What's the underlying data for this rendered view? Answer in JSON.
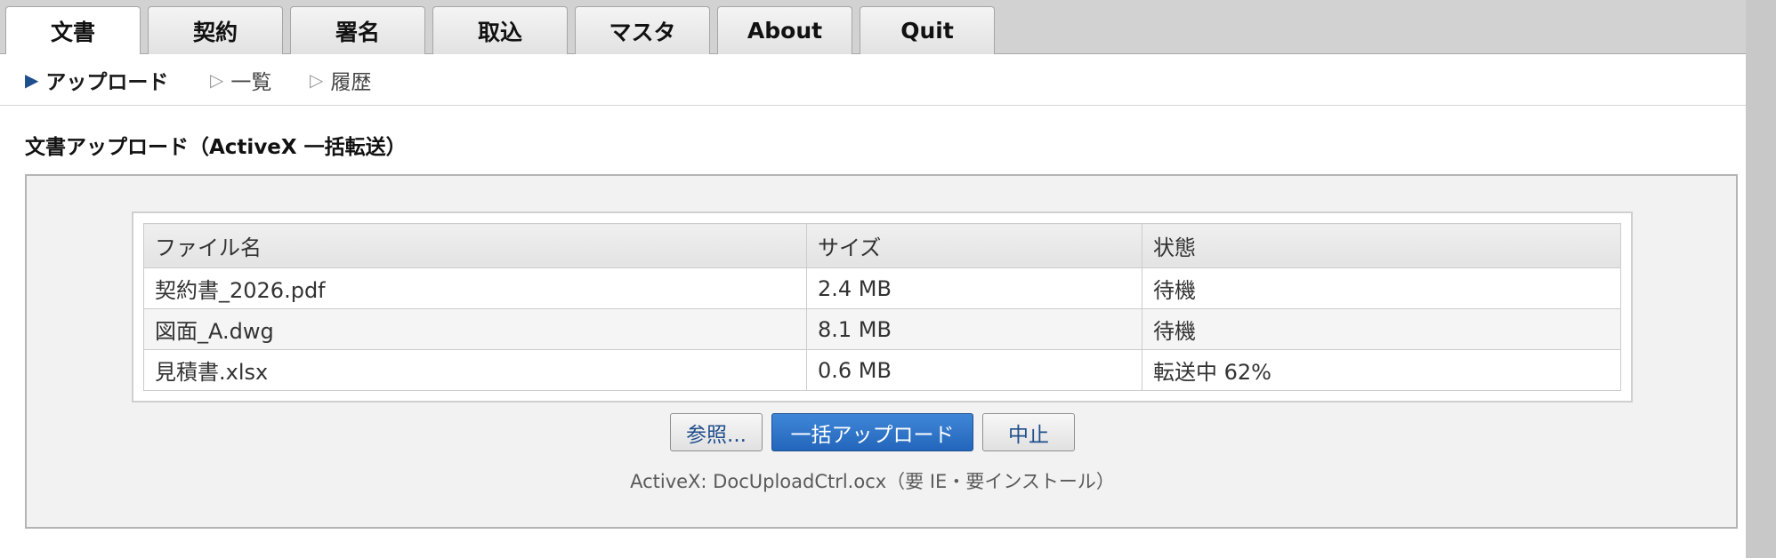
{
  "tabs": [
    "文書",
    "契約",
    "署名",
    "取込",
    "マスタ",
    "About",
    "Quit"
  ],
  "subnav": [
    {
      "label": "アップロード",
      "icon": "triangle-right-filled-icon"
    },
    {
      "label": "一覧",
      "icon": "triangle-right-outline-icon"
    },
    {
      "label": "履歴",
      "icon": "triangle-right-outline-icon"
    }
  ],
  "section_title": "文書アップロード（ActiveX 一括転送）",
  "table": {
    "headers": [
      "ファイル名",
      "サイズ",
      "状態"
    ],
    "rows": [
      [
        "契約書_2026.pdf",
        "2.4 MB",
        "待機"
      ],
      [
        "図面_A.dwg",
        "8.1 MB",
        "待機"
      ],
      [
        "見積書.xlsx",
        "0.6 MB",
        "転送中 62%"
      ]
    ]
  },
  "buttons": {
    "browse": "参照...",
    "upload_all": "一括アップロード",
    "cancel": "中止"
  },
  "footnote": "ActiveX: DocUploadCtrl.ocx（要 IE・要インストール）",
  "colors": {
    "accent": "#2366bb",
    "active_marker": "#1f4e8c"
  }
}
